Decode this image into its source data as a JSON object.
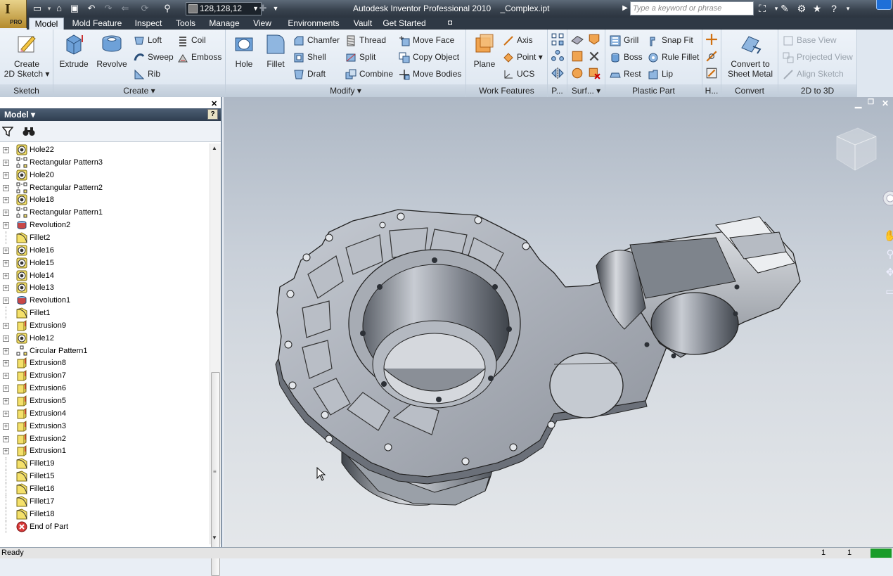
{
  "app": {
    "title": "Autodesk Inventor Professional 2010",
    "document": "_Complex.ipt",
    "logo_letter": "I",
    "edition_badge": "PRO",
    "search_placeholder": "Type a keyword or phrase",
    "color_value": "128,128,12"
  },
  "tabs": [
    "Model",
    "Mold Feature",
    "Inspect",
    "Tools",
    "Manage",
    "View",
    "Environments",
    "Vault",
    "Get Started"
  ],
  "active_tab": "Model",
  "ribbon": {
    "sketch": {
      "title": "Sketch",
      "create_label": "Create",
      "create_label2": "2D Sketch"
    },
    "create": {
      "title": "Create",
      "extrude": "Extrude",
      "revolve": "Revolve",
      "loft": "Loft",
      "sweep": "Sweep",
      "rib": "Rib",
      "coil": "Coil",
      "emboss": "Emboss"
    },
    "modify": {
      "title": "Modify",
      "hole": "Hole",
      "fillet": "Fillet",
      "chamfer": "Chamfer",
      "shell": "Shell",
      "draft": "Draft",
      "thread": "Thread",
      "split": "Split",
      "combine": "Combine",
      "move_face": "Move Face",
      "copy_object": "Copy Object",
      "move_bodies": "Move Bodies"
    },
    "work": {
      "title": "Work Features",
      "plane": "Plane",
      "axis": "Axis",
      "point": "Point",
      "ucs": "UCS"
    },
    "pattern": {
      "title": "P..."
    },
    "surface": {
      "title": "Surf..."
    },
    "plastic": {
      "title": "Plastic Part",
      "grill": "Grill",
      "boss": "Boss",
      "rest": "Rest",
      "snap_fit": "Snap Fit",
      "rule_fillet": "Rule Fillet",
      "lip": "Lip"
    },
    "harness": {
      "title": "H..."
    },
    "convert": {
      "title": "Convert",
      "label1": "Convert to",
      "label2": "Sheet Metal"
    },
    "twod3d": {
      "title": "2D to 3D",
      "base_view": "Base View",
      "projected_view": "Projected View",
      "align_sketch": "Align Sketch"
    }
  },
  "browser": {
    "title": "Model",
    "help": "?",
    "items": [
      {
        "label": "Hole22",
        "type": "hole"
      },
      {
        "label": "Rectangular Pattern3",
        "type": "rect-pattern"
      },
      {
        "label": "Hole20",
        "type": "hole"
      },
      {
        "label": "Rectangular Pattern2",
        "type": "rect-pattern"
      },
      {
        "label": "Hole18",
        "type": "hole"
      },
      {
        "label": "Rectangular Pattern1",
        "type": "rect-pattern"
      },
      {
        "label": "Revolution2",
        "type": "revolve"
      },
      {
        "label": "Fillet2",
        "type": "fillet"
      },
      {
        "label": "Hole16",
        "type": "hole"
      },
      {
        "label": "Hole15",
        "type": "hole"
      },
      {
        "label": "Hole14",
        "type": "hole"
      },
      {
        "label": "Hole13",
        "type": "hole"
      },
      {
        "label": "Revolution1",
        "type": "revolve"
      },
      {
        "label": "Fillet1",
        "type": "fillet"
      },
      {
        "label": "Extrusion9",
        "type": "extrude"
      },
      {
        "label": "Hole12",
        "type": "hole"
      },
      {
        "label": "Circular Pattern1",
        "type": "circ-pattern"
      },
      {
        "label": "Extrusion8",
        "type": "extrude"
      },
      {
        "label": "Extrusion7",
        "type": "extrude"
      },
      {
        "label": "Extrusion6",
        "type": "extrude"
      },
      {
        "label": "Extrusion5",
        "type": "extrude"
      },
      {
        "label": "Extrusion4",
        "type": "extrude"
      },
      {
        "label": "Extrusion3",
        "type": "extrude"
      },
      {
        "label": "Extrusion2",
        "type": "extrude"
      },
      {
        "label": "Extrusion1",
        "type": "extrude"
      },
      {
        "label": "Fillet19",
        "type": "fillet"
      },
      {
        "label": "Fillet15",
        "type": "fillet"
      },
      {
        "label": "Fillet16",
        "type": "fillet"
      },
      {
        "label": "Fillet17",
        "type": "fillet"
      },
      {
        "label": "Fillet18",
        "type": "fillet"
      },
      {
        "label": "End of Part",
        "type": "end"
      }
    ]
  },
  "status": {
    "text": "Ready",
    "num1": "1",
    "num2": "1"
  }
}
